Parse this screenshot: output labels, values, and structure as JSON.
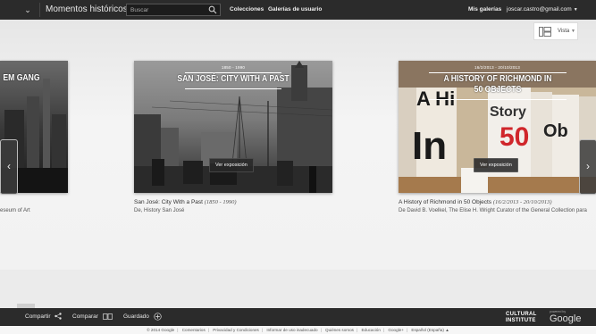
{
  "header": {
    "app_title": "Momentos históricos",
    "search_placeholder": "Buscar",
    "nav": [
      "Colecciones",
      "Galerías de usuario"
    ],
    "my_galleries": "Mis galerías",
    "user_email": "joscar.castro@gmail.com"
  },
  "view": {
    "label": "Vista"
  },
  "cards": [
    {
      "overlay_title": "EM GANG",
      "caption_sub": "eseum of Art"
    },
    {
      "dates": "1850 - 1990",
      "overlay_title": "SAN JOSÉ: CITY WITH A PAST",
      "button": "Ver exposición",
      "caption_title": "San José: City With a Past",
      "caption_dates": "(1850 - 1990)",
      "caption_sub": "De, History San José"
    },
    {
      "dates": "16/2/2013 - 20/10/2013",
      "overlay_title": "A HISTORY OF RICHMOND IN 50 OBJECTS",
      "button": "Ver exposición",
      "caption_title": "A History of Richmond in 50 Objects",
      "caption_dates": "(16/2/2013 - 20/10/2013)",
      "caption_sub": "De David B. Voelkel, The Elise H. Wright Curator of the General Collection para"
    }
  ],
  "bottombar": {
    "share": "Compartir",
    "compare": "Comparar",
    "saved": "Guardado",
    "logo_line1": "CULTURAL",
    "logo_line2": "INSTITUTE",
    "powered_by": "powered by",
    "google": "Google"
  },
  "footer": {
    "items": [
      "© 2014 Google",
      "Comentarios",
      "Privacidad y Condiciones",
      "Informar de uso inadecuado",
      "Quiénes somos",
      "Educación",
      "Google+",
      "Español (España)"
    ]
  },
  "colors": {
    "topbar": "#2b2b2b",
    "accent_red": "#d0262b"
  },
  "icons": [
    "chevron-down-icon",
    "search-icon",
    "grid-view-icon",
    "arrow-left-icon",
    "arrow-right-icon",
    "share-icon",
    "compare-icon",
    "add-icon",
    "caret-up-icon"
  ]
}
